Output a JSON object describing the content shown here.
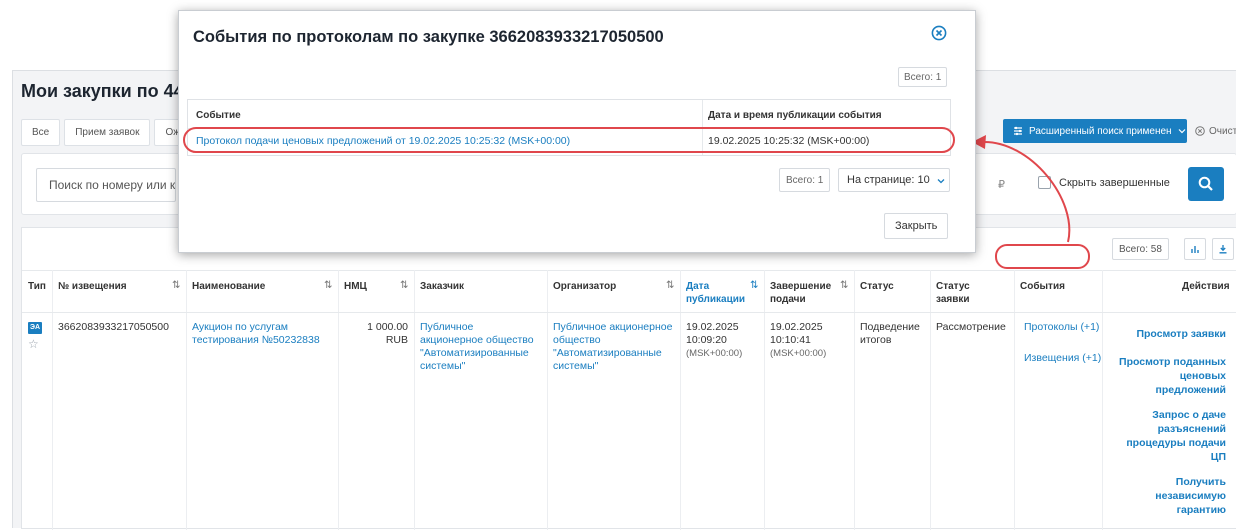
{
  "page": {
    "title": "Мои закупки по 44",
    "tabs": [
      "Все",
      "Прием заявок",
      "Ожи"
    ],
    "advanced_search_label": "Расширенный поиск применен",
    "clear_label": "Очистит",
    "search_placeholder": "Поиск по номеру или кл",
    "currency_symbol": "₽",
    "hide_completed_label": "Скрыть завершенные",
    "total_label": "Всего: 58"
  },
  "table": {
    "headers": {
      "type": "Тип",
      "notice": "№ извещения",
      "name": "Наименование",
      "nmc": "НМЦ",
      "customer": "Заказчик",
      "organizer": "Организатор",
      "pub_date_1": "Дата",
      "pub_date_2": "публикации",
      "end_1": "Завершение",
      "end_2": "подачи",
      "status": "Статус",
      "app_status_1": "Статус",
      "app_status_2": "заявки",
      "events": "События",
      "actions": "Действия"
    },
    "row": {
      "type_badge": "ЭА",
      "notice": "3662083933217050500",
      "name_1": "Аукцион по услугам",
      "name_2": "тестирования №50232838",
      "nmc_1": "1 000.00",
      "nmc_2": "RUB",
      "customer_1": "Публичное",
      "customer_2": "акционерное общество",
      "customer_3": "\"Автоматизированные",
      "customer_4": "системы\"",
      "organizer_1": "Публичное акционерное",
      "organizer_2": "общество",
      "organizer_3": "\"Автоматизированные",
      "organizer_4": "системы\"",
      "pub_date": "19.02.2025",
      "pub_time": "10:09:20",
      "pub_tz": "(MSK+00:00)",
      "end_date": "19.02.2025",
      "end_time": "10:10:41",
      "end_tz": "(MSK+00:00)",
      "status_1": "Подведение",
      "status_2": "итогов",
      "app_status": "Рассмотрение",
      "event_protocols": "Протоколы (+1)",
      "event_notices": "Извещения (+1)",
      "actions": {
        "view_app": "Просмотр заявки",
        "view_prices_1": "Просмотр поданных",
        "view_prices_2": "ценовых",
        "view_prices_3": "предложений",
        "request_1": "Запрос о даче",
        "request_2": "разъяснений",
        "request_3": "процедуры подачи",
        "request_4": "ЦП",
        "guarantee_1": "Получить",
        "guarantee_2": "независимую",
        "guarantee_3": "гарантию"
      }
    }
  },
  "modal": {
    "title": "События по протоколам по закупке 3662083933217050500",
    "count_top": "Всего: 1",
    "col_event": "Событие",
    "col_datetime": "Дата и время публикации события",
    "event_link": "Протокол подачи ценовых предложений от 19.02.2025 10:25:32 (MSK+00:00)",
    "event_datetime": "19.02.2025 10:25:32 (MSK+00:00)",
    "count_bottom": "Всего: 1",
    "per_page": "На странице: 10",
    "close_button": "Закрыть"
  },
  "colors": {
    "accent": "#1a7ec0",
    "highlight": "#e0474c"
  }
}
